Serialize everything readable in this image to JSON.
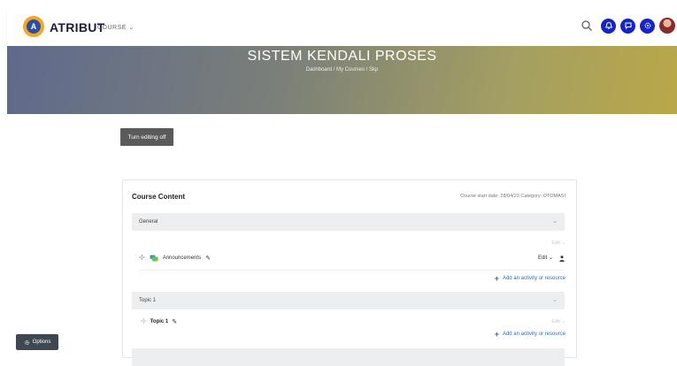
{
  "navbar": {
    "logo_letter": "A",
    "brand": "ATRIBUT",
    "course_menu": "COURSE ⌄"
  },
  "header": {
    "title": "SISTEM KENDALI PROSES",
    "breadcrumb": [
      "Dashboard",
      "My Courses",
      "Skp"
    ]
  },
  "edit_button": "Turn editing off",
  "course": {
    "title": "Course Content",
    "meta": "Course start date: 28/04/23  Category: OTOMASI",
    "sections": [
      {
        "name": "General",
        "edit_faint": "Edit ⌄",
        "activity": "Announcements",
        "activity_edit": "Edit ⌄",
        "add": "Add an activity or resource"
      },
      {
        "name": "Topic 1",
        "topic_title": "Topic 1",
        "edit_faint": "Edit ⌄",
        "add": "Add an activity or resource"
      }
    ]
  },
  "options_button": "Options",
  "colors": {
    "nav_circle": "#1524c8",
    "banner_start": "#5f6a8c",
    "banner_end": "#b9a849",
    "link": "#2a6ebb"
  }
}
